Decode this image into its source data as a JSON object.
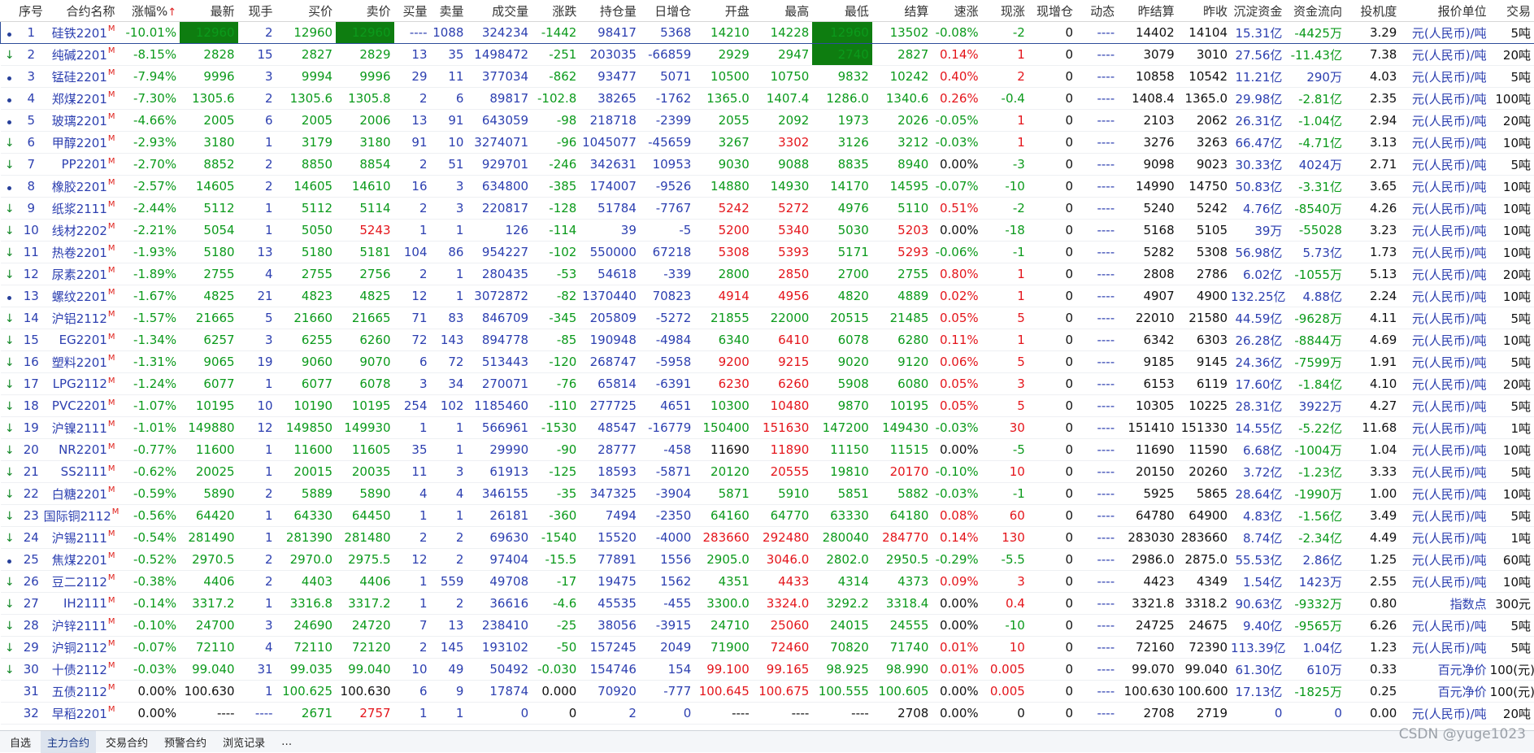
{
  "columns": [
    "序号",
    "合约名称",
    "涨幅%",
    "最新",
    "现手",
    "买价",
    "卖价",
    "买量",
    "卖量",
    "成交量",
    "涨跌",
    "持仓量",
    "日增仓",
    "开盘",
    "最高",
    "最低",
    "结算",
    "速涨",
    "现涨",
    "现增仓",
    "动态",
    "昨结算",
    "昨收",
    "沉淀资金",
    "资金流向",
    "投机度",
    "报价单位",
    "交易"
  ],
  "sort_indicator": "↑",
  "rows": [
    [
      "1",
      "硅铁2201",
      "-10.01%",
      "12960",
      "2",
      "12960",
      "12960",
      "----",
      "1088",
      "324234",
      "-1442",
      "98417",
      "5368",
      "14210",
      "14228",
      "12960",
      "13502",
      "-0.08%",
      "-2",
      "0",
      "----",
      "14402",
      "14104",
      "15.31亿",
      "-4425万",
      "3.29",
      "元(人民币)/吨",
      "5吨"
    ],
    [
      "2",
      "纯碱2201",
      "-8.15%",
      "2828",
      "15",
      "2827",
      "2829",
      "13",
      "35",
      "1498472",
      "-251",
      "203035",
      "-66859",
      "2929",
      "2947",
      "2740",
      "2827",
      "0.14%",
      "1",
      "0",
      "----",
      "3079",
      "3010",
      "27.56亿",
      "-11.43亿",
      "7.38",
      "元(人民币)/吨",
      "20吨"
    ],
    [
      "3",
      "锰硅2201",
      "-7.94%",
      "9996",
      "3",
      "9994",
      "9996",
      "29",
      "11",
      "377034",
      "-862",
      "93477",
      "5071",
      "10500",
      "10750",
      "9832",
      "10242",
      "0.40%",
      "2",
      "0",
      "----",
      "10858",
      "10542",
      "11.21亿",
      "290万",
      "4.03",
      "元(人民币)/吨",
      "5吨"
    ],
    [
      "4",
      "郑煤2201",
      "-7.30%",
      "1305.6",
      "2",
      "1305.6",
      "1305.8",
      "2",
      "6",
      "89817",
      "-102.8",
      "38265",
      "-1762",
      "1365.0",
      "1407.4",
      "1286.0",
      "1340.6",
      "0.26%",
      "-0.4",
      "0",
      "----",
      "1408.4",
      "1365.0",
      "29.98亿",
      "-2.81亿",
      "2.35",
      "元(人民币)/吨",
      "100吨"
    ],
    [
      "5",
      "玻璃2201",
      "-4.66%",
      "2005",
      "6",
      "2005",
      "2006",
      "13",
      "91",
      "643059",
      "-98",
      "218718",
      "-2399",
      "2055",
      "2092",
      "1973",
      "2026",
      "-0.05%",
      "1",
      "0",
      "----",
      "2103",
      "2062",
      "26.31亿",
      "-1.04亿",
      "2.94",
      "元(人民币)/吨",
      "20吨"
    ],
    [
      "6",
      "甲醇2201",
      "-2.93%",
      "3180",
      "1",
      "3179",
      "3180",
      "91",
      "10",
      "3274071",
      "-96",
      "1045077",
      "-45659",
      "3267",
      "3302",
      "3126",
      "3212",
      "-0.03%",
      "1",
      "0",
      "----",
      "3276",
      "3263",
      "66.47亿",
      "-4.71亿",
      "3.13",
      "元(人民币)/吨",
      "10吨"
    ],
    [
      "7",
      "PP2201",
      "-2.70%",
      "8852",
      "2",
      "8850",
      "8854",
      "2",
      "51",
      "929701",
      "-246",
      "342631",
      "10953",
      "9030",
      "9088",
      "8835",
      "8940",
      "0.00%",
      "-3",
      "0",
      "----",
      "9098",
      "9023",
      "30.33亿",
      "4024万",
      "2.71",
      "元(人民币)/吨",
      "5吨"
    ],
    [
      "8",
      "橡胶2201",
      "-2.57%",
      "14605",
      "2",
      "14605",
      "14610",
      "16",
      "3",
      "634800",
      "-385",
      "174007",
      "-9526",
      "14880",
      "14930",
      "14170",
      "14595",
      "-0.07%",
      "-10",
      "0",
      "----",
      "14990",
      "14750",
      "50.83亿",
      "-3.31亿",
      "3.65",
      "元(人民币)/吨",
      "10吨"
    ],
    [
      "9",
      "纸浆2111",
      "-2.44%",
      "5112",
      "1",
      "5112",
      "5114",
      "2",
      "3",
      "220817",
      "-128",
      "51784",
      "-7767",
      "5242",
      "5272",
      "4976",
      "5110",
      "0.51%",
      "-2",
      "0",
      "----",
      "5240",
      "5242",
      "4.76亿",
      "-8540万",
      "4.26",
      "元(人民币)/吨",
      "10吨"
    ],
    [
      "10",
      "线材2202",
      "-2.21%",
      "5054",
      "1",
      "5050",
      "5243",
      "1",
      "1",
      "126",
      "-114",
      "39",
      "-5",
      "5200",
      "5340",
      "5030",
      "5203",
      "0.00%",
      "-18",
      "0",
      "----",
      "5168",
      "5105",
      "39万",
      "-55028",
      "3.23",
      "元(人民币)/吨",
      "10吨"
    ],
    [
      "11",
      "热卷2201",
      "-1.93%",
      "5180",
      "13",
      "5180",
      "5181",
      "104",
      "86",
      "954227",
      "-102",
      "550000",
      "67218",
      "5308",
      "5393",
      "5171",
      "5293",
      "-0.06%",
      "-1",
      "0",
      "----",
      "5282",
      "5308",
      "56.98亿",
      "5.73亿",
      "1.73",
      "元(人民币)/吨",
      "10吨"
    ],
    [
      "12",
      "尿素2201",
      "-1.89%",
      "2755",
      "4",
      "2755",
      "2756",
      "2",
      "1",
      "280435",
      "-53",
      "54618",
      "-339",
      "2800",
      "2850",
      "2700",
      "2755",
      "0.80%",
      "1",
      "0",
      "----",
      "2808",
      "2786",
      "6.02亿",
      "-1055万",
      "5.13",
      "元(人民币)/吨",
      "20吨"
    ],
    [
      "13",
      "螺纹2201",
      "-1.67%",
      "4825",
      "21",
      "4823",
      "4825",
      "12",
      "1",
      "3072872",
      "-82",
      "1370440",
      "70823",
      "4914",
      "4956",
      "4820",
      "4889",
      "0.02%",
      "1",
      "0",
      "----",
      "4907",
      "4900",
      "132.25亿",
      "4.88亿",
      "2.24",
      "元(人民币)/吨",
      "10吨"
    ],
    [
      "14",
      "沪铝2112",
      "-1.57%",
      "21665",
      "5",
      "21660",
      "21665",
      "71",
      "83",
      "846709",
      "-345",
      "205809",
      "-5272",
      "21855",
      "22000",
      "20515",
      "21485",
      "0.05%",
      "5",
      "0",
      "----",
      "22010",
      "21580",
      "44.59亿",
      "-9628万",
      "4.11",
      "元(人民币)/吨",
      "5吨"
    ],
    [
      "15",
      "EG2201",
      "-1.34%",
      "6257",
      "3",
      "6255",
      "6260",
      "72",
      "143",
      "894778",
      "-85",
      "190948",
      "-4984",
      "6340",
      "6410",
      "6078",
      "6280",
      "0.11%",
      "1",
      "0",
      "----",
      "6342",
      "6303",
      "26.28亿",
      "-8844万",
      "4.69",
      "元(人民币)/吨",
      "10吨"
    ],
    [
      "16",
      "塑料2201",
      "-1.31%",
      "9065",
      "19",
      "9060",
      "9070",
      "6",
      "72",
      "513443",
      "-120",
      "268747",
      "-5958",
      "9200",
      "9215",
      "9020",
      "9120",
      "0.06%",
      "5",
      "0",
      "----",
      "9185",
      "9145",
      "24.36亿",
      "-7599万",
      "1.91",
      "元(人民币)/吨",
      "5吨"
    ],
    [
      "17",
      "LPG2112",
      "-1.24%",
      "6077",
      "1",
      "6077",
      "6078",
      "3",
      "34",
      "270071",
      "-76",
      "65814",
      "-6391",
      "6230",
      "6260",
      "5908",
      "6080",
      "0.05%",
      "3",
      "0",
      "----",
      "6153",
      "6119",
      "17.60亿",
      "-1.84亿",
      "4.10",
      "元(人民币)/吨",
      "20吨"
    ],
    [
      "18",
      "PVC2201",
      "-1.07%",
      "10195",
      "10",
      "10190",
      "10195",
      "254",
      "102",
      "1185460",
      "-110",
      "277725",
      "4651",
      "10300",
      "10480",
      "9870",
      "10195",
      "0.05%",
      "5",
      "0",
      "----",
      "10305",
      "10225",
      "28.31亿",
      "3922万",
      "4.27",
      "元(人民币)/吨",
      "5吨"
    ],
    [
      "19",
      "沪镍2111",
      "-1.01%",
      "149880",
      "12",
      "149850",
      "149930",
      "1",
      "1",
      "566961",
      "-1530",
      "48547",
      "-16779",
      "150400",
      "151630",
      "147200",
      "149430",
      "-0.03%",
      "30",
      "0",
      "----",
      "151410",
      "151330",
      "14.55亿",
      "-5.22亿",
      "11.68",
      "元(人民币)/吨",
      "1吨"
    ],
    [
      "20",
      "NR2201",
      "-0.77%",
      "11600",
      "1",
      "11600",
      "11605",
      "35",
      "1",
      "29990",
      "-90",
      "28777",
      "-458",
      "11690",
      "11890",
      "11150",
      "11515",
      "0.00%",
      "-5",
      "0",
      "----",
      "11690",
      "11590",
      "6.68亿",
      "-1004万",
      "1.04",
      "元(人民币)/吨",
      "10吨"
    ],
    [
      "21",
      "SS2111",
      "-0.62%",
      "20025",
      "1",
      "20015",
      "20035",
      "11",
      "3",
      "61913",
      "-125",
      "18593",
      "-5871",
      "20120",
      "20555",
      "19810",
      "20170",
      "-0.10%",
      "10",
      "0",
      "----",
      "20150",
      "20260",
      "3.72亿",
      "-1.23亿",
      "3.33",
      "元(人民币)/吨",
      "5吨"
    ],
    [
      "22",
      "白糖2201",
      "-0.59%",
      "5890",
      "2",
      "5889",
      "5890",
      "4",
      "4",
      "346155",
      "-35",
      "347325",
      "-3904",
      "5871",
      "5910",
      "5851",
      "5882",
      "-0.03%",
      "-1",
      "0",
      "----",
      "5925",
      "5865",
      "28.64亿",
      "-1990万",
      "1.00",
      "元(人民币)/吨",
      "10吨"
    ],
    [
      "23",
      "国际铜2112",
      "-0.56%",
      "64420",
      "1",
      "64330",
      "64450",
      "1",
      "1",
      "26181",
      "-360",
      "7494",
      "-2350",
      "64160",
      "64770",
      "63330",
      "64180",
      "0.08%",
      "60",
      "0",
      "----",
      "64780",
      "64900",
      "4.83亿",
      "-1.56亿",
      "3.49",
      "元(人民币)/吨",
      "5吨"
    ],
    [
      "24",
      "沪锡2111",
      "-0.54%",
      "281490",
      "1",
      "281390",
      "281480",
      "2",
      "2",
      "69630",
      "-1540",
      "15520",
      "-4000",
      "283660",
      "292480",
      "280040",
      "284770",
      "0.14%",
      "130",
      "0",
      "----",
      "283030",
      "283660",
      "8.74亿",
      "-2.34亿",
      "4.49",
      "元(人民币)/吨",
      "1吨"
    ],
    [
      "25",
      "焦煤2201",
      "-0.52%",
      "2970.5",
      "2",
      "2970.0",
      "2975.5",
      "12",
      "2",
      "97404",
      "-15.5",
      "77891",
      "1556",
      "2905.0",
      "3046.0",
      "2802.0",
      "2950.5",
      "-0.29%",
      "-5.5",
      "0",
      "----",
      "2986.0",
      "2875.0",
      "55.53亿",
      "2.86亿",
      "1.25",
      "元(人民币)/吨",
      "60吨"
    ],
    [
      "26",
      "豆二2112",
      "-0.38%",
      "4406",
      "2",
      "4403",
      "4406",
      "1",
      "559",
      "49708",
      "-17",
      "19475",
      "1562",
      "4351",
      "4433",
      "4314",
      "4373",
      "0.09%",
      "3",
      "0",
      "----",
      "4423",
      "4349",
      "1.54亿",
      "1423万",
      "2.55",
      "元(人民币)/吨",
      "10吨"
    ],
    [
      "27",
      "IH2111",
      "-0.14%",
      "3317.2",
      "1",
      "3316.8",
      "3317.2",
      "1",
      "2",
      "36616",
      "-4.6",
      "45535",
      "-455",
      "3300.0",
      "3324.0",
      "3292.2",
      "3318.4",
      "0.00%",
      "0.4",
      "0",
      "----",
      "3321.8",
      "3318.2",
      "90.63亿",
      "-9332万",
      "0.80",
      "指数点",
      "300元"
    ],
    [
      "28",
      "沪锌2111",
      "-0.10%",
      "24700",
      "3",
      "24690",
      "24720",
      "7",
      "13",
      "238410",
      "-25",
      "38056",
      "-3915",
      "24710",
      "25060",
      "24015",
      "24555",
      "0.00%",
      "-10",
      "0",
      "----",
      "24725",
      "24675",
      "9.40亿",
      "-9565万",
      "6.26",
      "元(人民币)/吨",
      "5吨"
    ],
    [
      "29",
      "沪铜2112",
      "-0.07%",
      "72110",
      "4",
      "72110",
      "72120",
      "2",
      "145",
      "193102",
      "-50",
      "157245",
      "2049",
      "71900",
      "72460",
      "70820",
      "71740",
      "0.01%",
      "10",
      "0",
      "----",
      "72160",
      "72390",
      "113.39亿",
      "1.04亿",
      "1.23",
      "元(人民币)/吨",
      "5吨"
    ],
    [
      "30",
      "十债2112",
      "-0.03%",
      "99.040",
      "31",
      "99.035",
      "99.040",
      "10",
      "49",
      "50492",
      "-0.030",
      "154746",
      "154",
      "99.100",
      "99.165",
      "98.925",
      "98.990",
      "0.01%",
      "0.005",
      "0",
      "----",
      "99.070",
      "99.040",
      "61.30亿",
      "610万",
      "0.33",
      "百元净价",
      "100(元)"
    ],
    [
      "31",
      "五债2112",
      "0.00%",
      "100.630",
      "1",
      "100.625",
      "100.630",
      "6",
      "9",
      "17874",
      "0.000",
      "70920",
      "-777",
      "100.645",
      "100.675",
      "100.555",
      "100.605",
      "0.00%",
      "0.005",
      "0",
      "----",
      "100.630",
      "100.600",
      "17.13亿",
      "-1825万",
      "0.25",
      "百元净价",
      "100(元)"
    ],
    [
      "32",
      "早稻2201",
      "0.00%",
      "----",
      "----",
      "2671",
      "2757",
      "1",
      "1",
      "0",
      "0",
      "2",
      "0",
      "----",
      "----",
      "----",
      "2708",
      "0.00%",
      "0",
      "0",
      "----",
      "2708",
      "2719",
      "0",
      "0",
      "0.00",
      "元(人民币)/吨",
      "20吨"
    ]
  ],
  "row_markers": [
    "dot",
    "arrow",
    "dot",
    "dot",
    "dot",
    "arrow",
    "arrow",
    "dot",
    "arrow",
    "arrow",
    "arrow",
    "arrow",
    "dot",
    "arrow",
    "arrow",
    "arrow",
    "arrow",
    "arrow",
    "arrow",
    "arrow",
    "arrow",
    "arrow",
    "arrow",
    "arrow",
    "dot",
    "arrow",
    "arrow",
    "arrow",
    "arrow",
    "arrow",
    "none",
    "none"
  ],
  "tabs": [
    {
      "label": "自选",
      "active": false
    },
    {
      "label": "主力合约",
      "active": true
    },
    {
      "label": "交易合约",
      "active": false
    },
    {
      "label": "预警合约",
      "active": false
    },
    {
      "label": "浏览记录",
      "active": false
    },
    {
      "label": "…",
      "active": false
    }
  ],
  "watermark": "CSDN @yuge1023",
  "colors": {
    "up": "#e4151b",
    "down": "#0b9a1b",
    "neutral": "#2c3fb0",
    "highlight": "#0e7d10"
  }
}
